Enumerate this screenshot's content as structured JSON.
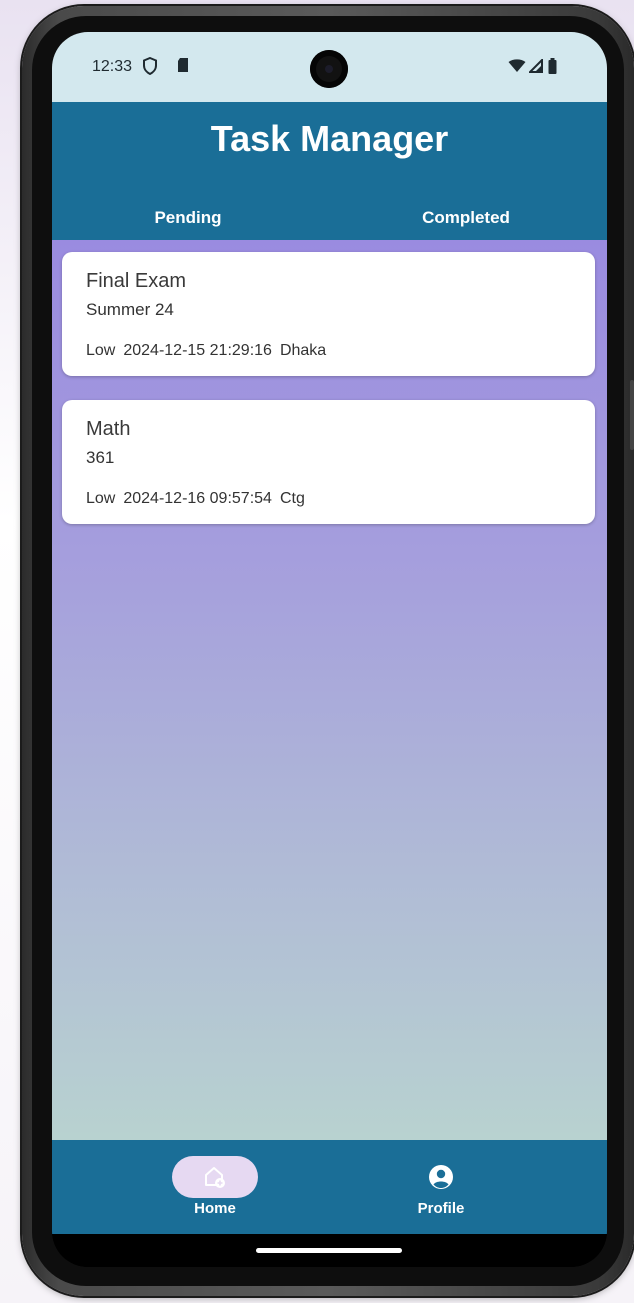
{
  "status_bar": {
    "time": "12:33",
    "left_icons": [
      "shield-icon",
      "sd-card-icon"
    ],
    "right_icons": [
      "wifi-icon",
      "signal-icon",
      "battery-icon"
    ]
  },
  "app_bar": {
    "title": "Task Manager",
    "tabs": [
      {
        "label": "Pending"
      },
      {
        "label": "Completed"
      }
    ]
  },
  "tasks": [
    {
      "title": "Final Exam",
      "subtitle": "Summer 24",
      "priority": "Low",
      "datetime": "2024-12-15 21:29:16",
      "location": "Dhaka"
    },
    {
      "title": "Math",
      "subtitle": "361",
      "priority": "Low",
      "datetime": "2024-12-16 09:57:54",
      "location": "Ctg"
    }
  ],
  "bottom_nav": {
    "items": [
      {
        "label": "Home",
        "icon": "home-add-icon",
        "selected": true
      },
      {
        "label": "Profile",
        "icon": "account-circle-icon",
        "selected": false
      }
    ]
  },
  "colors": {
    "app_bar": "#1a6e97",
    "status_bar": "#d3e8ee",
    "nav_pill": "#e6d9f2",
    "card": "#ffffff"
  }
}
